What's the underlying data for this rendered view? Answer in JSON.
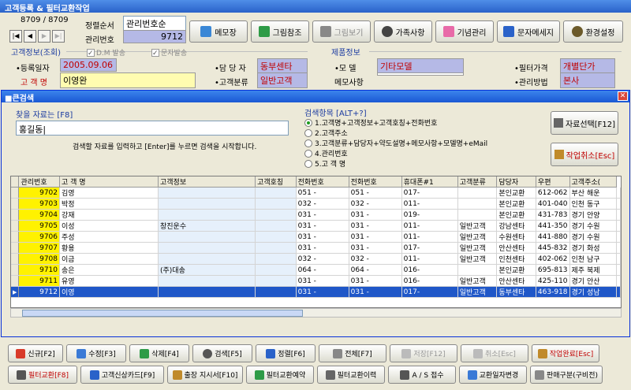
{
  "window": {
    "title": "고객등록 & 필터교환작업"
  },
  "record": {
    "counter": "8709 / 8709"
  },
  "header": {
    "sort_label": "정렬순서",
    "sort_value": "관리번호순",
    "id_label": "관리번호",
    "id_value": "9712"
  },
  "toolbar": [
    {
      "label": "메모장"
    },
    {
      "label": "그림참조"
    },
    {
      "label": "그림보기"
    },
    {
      "label": "가족사항"
    },
    {
      "label": "기념관리"
    },
    {
      "label": "문자메세지"
    },
    {
      "label": "환경설정"
    }
  ],
  "customer": {
    "group_title": "고객정보(조회)",
    "chk_dh": "D.M 발송",
    "chk_sms": "문자발송",
    "reg_label": "•등록일자",
    "reg_value": "2005.09.06",
    "name_label": "고 객 명",
    "name_value": "이영완",
    "manager_label": "•담 당 자",
    "manager_value": "동부센타",
    "class_label": "•고객분류",
    "class_value": "일반고객"
  },
  "product": {
    "group_title": "제품정보",
    "model_label": "•모    델",
    "model_value": "기타모델",
    "memo_label": "메모사항",
    "price_label": "•필터가격",
    "price_value": "개별단가",
    "method_label": "•관리방법",
    "method_value": "본사"
  },
  "dialog": {
    "title": "■큰검색",
    "search_label": "찾을 자료는 [F8]",
    "search_value": "홍길동|",
    "hint": "검색할 자료를 입력하고 [Enter]를 누르면 검색을 시작합니다.",
    "options_title": "검색항목 [ALT+?]",
    "options": [
      "1.고객명+고객정보+고객호칭+전화번호",
      "2.고객주소",
      "3.고객분류+담당자+약도설명+메모사항+모델명+eMail",
      "4.관리번호",
      "5.고 객 명"
    ],
    "select_button": "자료선택[F12]",
    "cancel_button": "작업취소[Esc]"
  },
  "grid": {
    "columns": [
      "관리번호",
      "고 객 명",
      "고객정보",
      "고객호칭",
      "전화번호",
      "전화번호",
      "휴대폰#1",
      "고객분류",
      "담당자",
      "우편",
      "고객주소("
    ],
    "rows": [
      [
        "9702",
        "김영",
        "",
        "",
        "051 -",
        "051 -",
        "017-",
        "",
        "본인교환",
        "612-062",
        "부산 해운"
      ],
      [
        "9703",
        "박정",
        "",
        "",
        "032 -",
        "032 -",
        "011-",
        "",
        "본인교환",
        "401-040",
        "인천 동구"
      ],
      [
        "9704",
        "강재",
        "",
        "",
        "031 -",
        "031 -",
        "019-",
        "",
        "본인교환",
        "431-783",
        "경기 안양"
      ],
      [
        "9705",
        "이성",
        "창진운수",
        "",
        "031 -",
        "031 -",
        "011-",
        "일반고객",
        "강남센타",
        "441-350",
        "경기 수원"
      ],
      [
        "9706",
        "주성",
        "",
        "",
        "031 -",
        "031 -",
        "011-",
        "일반고객",
        "수원센타",
        "441-880",
        "경기 수원"
      ],
      [
        "9707",
        "황용",
        "",
        "",
        "031 -",
        "031 -",
        "017-",
        "일반고객",
        "안산센타",
        "445-832",
        "경기 화성"
      ],
      [
        "9708",
        "이금",
        "",
        "",
        "032 -",
        "032 -",
        "011-",
        "일반고객",
        "인천센타",
        "402-062",
        "인천 남구"
      ],
      [
        "9710",
        "송은",
        "(주)대송",
        "",
        "064 -",
        "064 -",
        "016-",
        "",
        "본인교환",
        "695-813",
        "제주 북제"
      ],
      [
        "9711",
        "유영",
        "",
        "",
        "031 -",
        "031 -",
        "016-",
        "일반고객",
        "안산센타",
        "425-110",
        "경기 안산"
      ],
      [
        "9712",
        "이영",
        "",
        "",
        "031 -",
        "031 -",
        "017-",
        "일반고객",
        "동부센타",
        "463-918",
        "경기 성남"
      ]
    ],
    "selected_index": 9
  },
  "bottom_row1": [
    {
      "label": "신규[F2]"
    },
    {
      "label": "수정[F3]"
    },
    {
      "label": "삭제[F4]"
    },
    {
      "label": "검색[F5]"
    },
    {
      "label": "정렬[F6]"
    },
    {
      "label": "전체[F7]"
    },
    {
      "label": "저장[F12]"
    },
    {
      "label": "취소[Esc]"
    },
    {
      "label": "작업완료[Esc]"
    }
  ],
  "bottom_row2": [
    {
      "label": "필터교환[F8]"
    },
    {
      "label": "고객신상카드[F9]"
    },
    {
      "label": "출장 지시서[F10]"
    },
    {
      "label": "필터교환예약"
    },
    {
      "label": "필터교환이력"
    },
    {
      "label": "A / S 접수"
    },
    {
      "label": "교환일자변경"
    },
    {
      "label": "판매구분(구비전)"
    }
  ],
  "colors": {
    "accent": "#2a62c9",
    "value_bg": "#b5b9e6",
    "selected_row": "#1f57c8",
    "id_cell": "#fff200"
  }
}
